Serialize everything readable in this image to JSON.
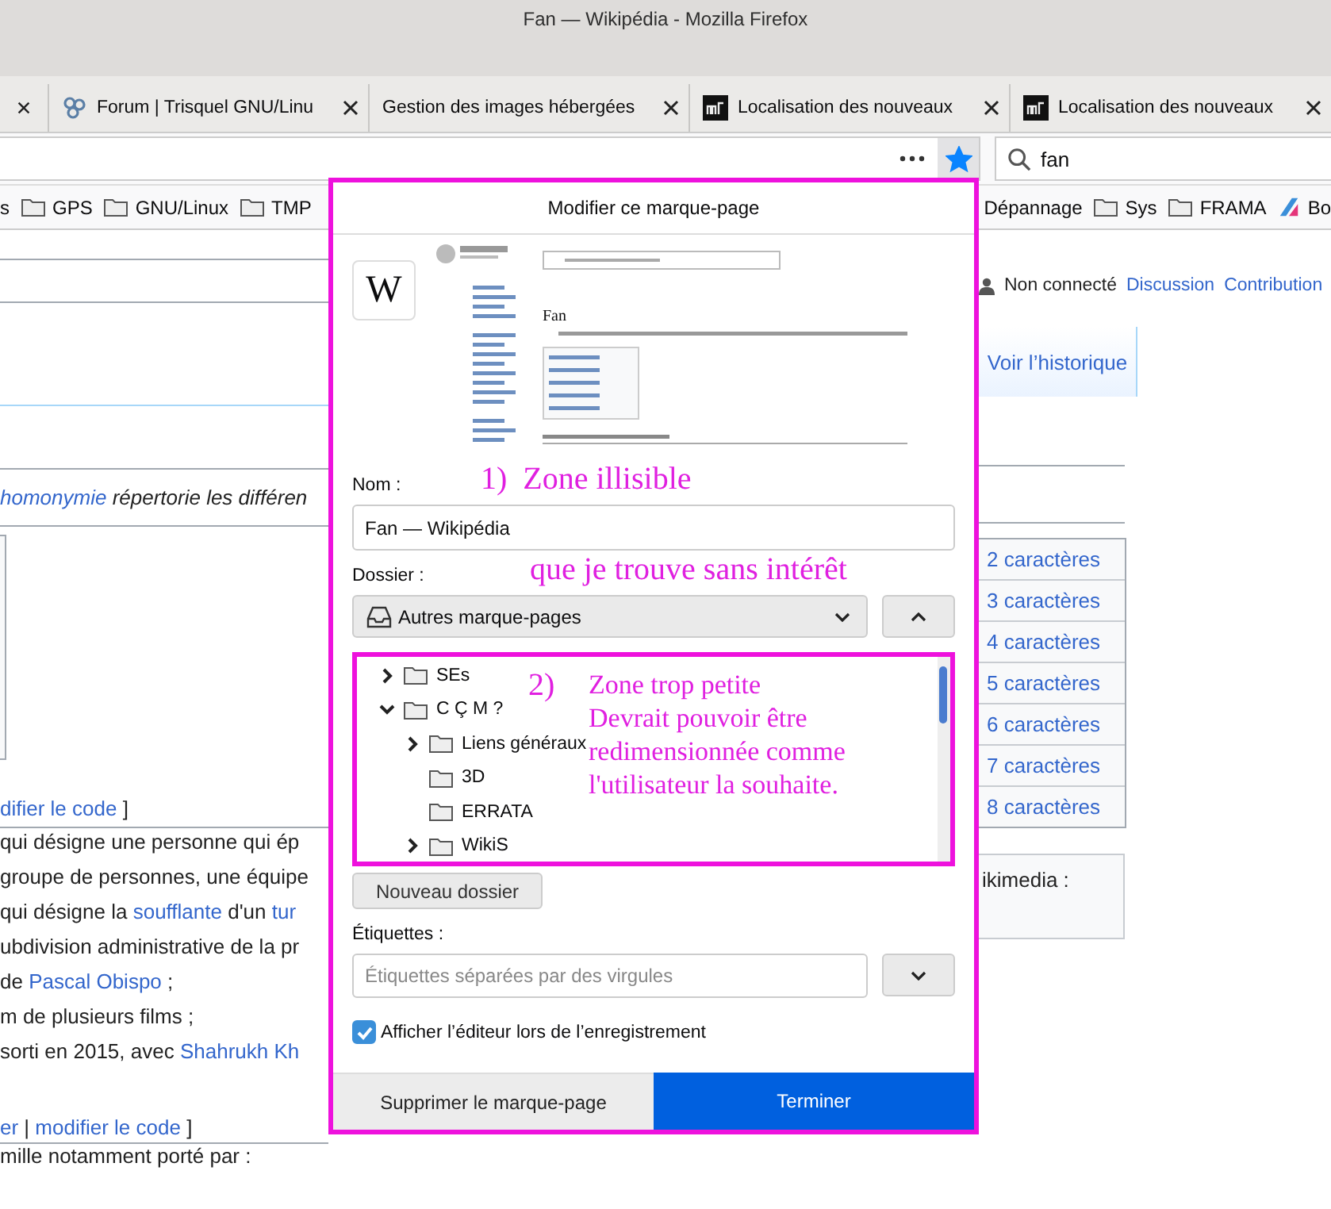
{
  "window": {
    "title": "Fan — Wikipédia - Mozilla Firefox"
  },
  "tabs": [
    {
      "kind": "clipped"
    },
    {
      "kind": "full",
      "title": "Forum | Trisquel GNU/Linu"
    },
    {
      "kind": "full",
      "title": "Gestion des images hébergées"
    },
    {
      "kind": "full",
      "title": "Localisation des nouveaux"
    },
    {
      "kind": "full",
      "title": "Localisation des nouveaux"
    }
  ],
  "toolbar": {
    "bookmarked": true,
    "search": {
      "value": "fan"
    }
  },
  "bookmarks_bar": {
    "left": [
      {
        "label": "s",
        "kind": "text"
      },
      {
        "label": "GPS",
        "kind": "folder"
      },
      {
        "label": "GNU/Linux",
        "kind": "folder"
      },
      {
        "label": "TMP",
        "kind": "folder"
      }
    ],
    "right": [
      {
        "label": "Dépannage",
        "kind": "text"
      },
      {
        "label": "Sys",
        "kind": "folder"
      },
      {
        "label": "FRAMA",
        "kind": "folder"
      },
      {
        "label": "Bo",
        "kind": "site"
      }
    ]
  },
  "page": {
    "user": {
      "status": "Non connecté",
      "links": [
        "Discussion",
        "Contribution"
      ]
    },
    "history_tab": "Voir l’historique",
    "hatnote": [
      {
        "link": "homonymie"
      },
      " répertorie les différen"
    ],
    "edit_link_1": [
      {
        "link": "difier le code"
      },
      " ]"
    ],
    "list": [
      [
        "qui désigne une personne qui ép"
      ],
      [
        "groupe de personnes, une équipe"
      ],
      [
        "qui désigne la ",
        {
          "link": "soufflante"
        },
        " d'un ",
        {
          "link": "tur"
        }
      ],
      [
        "ubdivision administrative de la pr"
      ],
      [
        "de ",
        {
          "link": "Pascal Obispo"
        },
        " ;"
      ],
      [
        "m de plusieurs films ;"
      ],
      [
        "sorti en 2015, avec ",
        {
          "link": "Shahrukh Kh"
        }
      ]
    ],
    "edit_link_2": [
      {
        "link": "er"
      },
      " | ",
      {
        "link": "modifier le code"
      },
      " ]"
    ],
    "last_line": "mille notamment porté par :",
    "side_rows": [
      "2 caractères",
      "3 caractères",
      "4 caractères",
      "5 caractères",
      "6 caractères",
      "7 caractères",
      "8 caractères"
    ],
    "side_box": "ikimedia :"
  },
  "dialog": {
    "title": "Modifier ce marque-page",
    "preview": {
      "logo": "W",
      "heading": "Fan"
    },
    "name": {
      "label": "Nom :",
      "value": "Fan — Wikipédia"
    },
    "folder": {
      "label": "Dossier :",
      "value": "Autres marque-pages",
      "expanded": true
    },
    "tree": [
      {
        "label": "SEs",
        "expanded": false
      },
      {
        "label": "C Ç M ?",
        "expanded": true,
        "children": [
          {
            "label": "Liens généraux",
            "expanded": false
          },
          {
            "label": "3D"
          },
          {
            "label": "ERRATA"
          },
          {
            "label": "WikiS",
            "expanded": false
          }
        ]
      }
    ],
    "new_folder_button": "Nouveau dossier",
    "tags": {
      "label": "Étiquettes :",
      "placeholder": "Étiquettes séparées par des virgules"
    },
    "show_editor": {
      "label": "Afficher l’éditeur lors de l’enregistrement",
      "checked": true
    },
    "buttons": {
      "remove": "Supprimer le marque-page",
      "done": "Terminer"
    }
  },
  "annotations": [
    {
      "lines": [
        "1)  Zone illisible"
      ]
    },
    {
      "lines": [
        "que je trouve sans intérêt"
      ]
    },
    {
      "lines": [
        "2)"
      ]
    },
    {
      "lines": [
        "Zone trop petite",
        "Devrait pouvoir être",
        "redimensionnée comme",
        "l'utilisateur la souhaite."
      ]
    }
  ]
}
